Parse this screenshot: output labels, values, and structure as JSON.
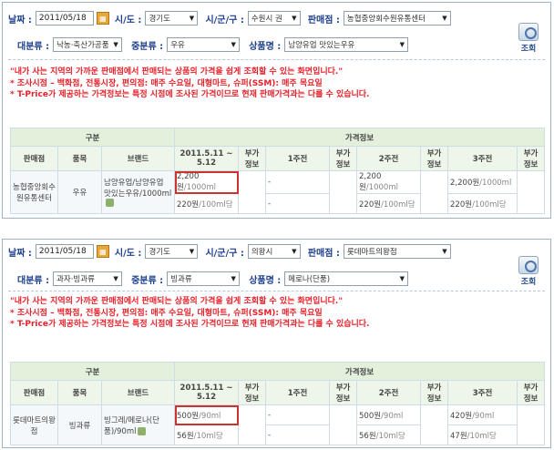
{
  "labels": {
    "date": "날짜 :",
    "sido": "시/도 :",
    "sigungu": "시/군/구 :",
    "store": "판매점 :",
    "category_major": "대분류 :",
    "category_middle": "중분류 :",
    "product": "상품명 :",
    "search": "조회"
  },
  "notice": {
    "line1": "\"내가 사는 지역의 가까운 판매점에서 판매되는 상품의 가격을 쉽게 조회할 수 있는 화면입니다.\"",
    "line2": "* 조사시점 – 백화점, 전통시장, 편의점: 매주 수요일, 대형마트, 슈퍼(SSM): 매주 목요일",
    "line3": "* T-Price가 제공하는 가격정보는 특정 시점에 조사된 가격이므로 현재 판매가격과는 다를 수 있습니다."
  },
  "table_headers": {
    "group": "구분",
    "price_info": "가격정보",
    "store": "판매점",
    "item": "품목",
    "brand": "브랜드",
    "date_col": "2011.5.11 ~ 5.12",
    "vat": "부가 정보",
    "w1": "1주전",
    "w2": "2주전",
    "w3": "3주전"
  },
  "panels": [
    {
      "date": "2011/05/18",
      "sido": "경기도",
      "sigungu": "수원시 권",
      "store": "농협중앙회수원유통센터",
      "category_major": "낙농·축산가공품",
      "category_middle": "우유",
      "product": "남양유업 맛있는우유",
      "row": {
        "store": "농협중앙회수원유통센터",
        "item": "우유",
        "brand": "남양유업/남양유업 맛있는우유/1000ml",
        "cur_price": "2,200원",
        "cur_unit": "/1000ml",
        "cur_per": "220원",
        "cur_per_unit": "/100ml당",
        "w1_price": "-",
        "w1_per": "-",
        "w2_price": "2,200원",
        "w2_unit": "/1000ml",
        "w2_per": "220원",
        "w2_per_unit": "/100ml당",
        "w3_price": "2,200원",
        "w3_unit": "/1000ml",
        "w3_per": "220원",
        "w3_per_unit": "/100ml당"
      }
    },
    {
      "date": "2011/05/18",
      "sido": "경기도",
      "sigungu": "의왕시",
      "store": "롯데마트의왕점",
      "category_major": "과자·빙과류",
      "category_middle": "빙과류",
      "product": "메로나(단품)",
      "row": {
        "store": "롯데마트의왕점",
        "item": "빙과류",
        "brand": "빙그레/메로나(단품)/90ml",
        "cur_price": "500원",
        "cur_unit": "/90ml",
        "cur_per": "56원",
        "cur_per_unit": "/10ml당",
        "w1_price": "-",
        "w1_per": "-",
        "w2_price": "500원",
        "w2_unit": "/90ml",
        "w2_per": "56원",
        "w2_per_unit": "/10ml당",
        "w3_price": "420원",
        "w3_unit": "/90ml",
        "w3_per": "47원",
        "w3_per_unit": "/10ml당"
      }
    }
  ]
}
